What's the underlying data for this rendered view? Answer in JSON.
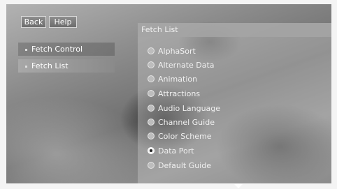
{
  "top_buttons": {
    "back_label": "Back",
    "help_label": "Help"
  },
  "sidebar": {
    "items": [
      {
        "label": "Fetch Control",
        "selected": false
      },
      {
        "label": "Fetch List",
        "selected": true
      }
    ]
  },
  "panel": {
    "title": "Fetch List",
    "options": [
      {
        "label": "AlphaSort",
        "selected": false
      },
      {
        "label": "Alternate Data",
        "selected": false
      },
      {
        "label": "Animation",
        "selected": false
      },
      {
        "label": "Attractions",
        "selected": false
      },
      {
        "label": "Audio Language",
        "selected": false
      },
      {
        "label": "Channel Guide",
        "selected": false
      },
      {
        "label": "Color Scheme",
        "selected": false
      },
      {
        "label": "Data Port",
        "selected": true
      },
      {
        "label": "Default Guide",
        "selected": false
      }
    ]
  },
  "icons": {
    "radio": "radio-button-icon",
    "scroll": "scroll-down-arrow-icon"
  },
  "colors": {
    "frame": "#f4f4f4",
    "text": "#ffffff",
    "selected_item": "#a8a8a8"
  }
}
